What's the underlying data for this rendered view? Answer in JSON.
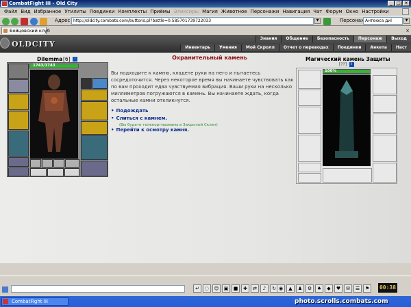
{
  "window": {
    "title": "CombatFight III - Old City"
  },
  "menu": [
    {
      "label": "Файл",
      "disabled": false
    },
    {
      "label": "Вид",
      "disabled": false
    },
    {
      "label": "Избранное",
      "disabled": false
    },
    {
      "label": "Утилиты",
      "disabled": false
    },
    {
      "label": "Поединки",
      "disabled": false
    },
    {
      "label": "Комплекты",
      "disabled": false
    },
    {
      "label": "Приёмы",
      "disabled": false
    },
    {
      "label": "Эликсиры",
      "disabled": true
    },
    {
      "label": "Магия",
      "disabled": false
    },
    {
      "label": "Животное",
      "disabled": false
    },
    {
      "label": "Персонажи",
      "disabled": false
    },
    {
      "label": "Навигация",
      "disabled": false
    },
    {
      "label": "Чат",
      "disabled": false
    },
    {
      "label": "Форум",
      "disabled": false
    },
    {
      "label": "Окно",
      "disabled": false
    },
    {
      "label": "Настройки",
      "disabled": false
    }
  ],
  "address": {
    "label": "Адрес",
    "url": "http://oldcity.combats.com/buttons.pl?battle=0.585701739722033",
    "persona_label": "Персонаж",
    "persona_value": "Антеюса диl"
  },
  "tab": {
    "label": "Бойцовский клуб"
  },
  "header": {
    "logo": "OLDCITY",
    "nav_top": [
      "Знания",
      "Общение",
      "Безопасность",
      "Персонаж",
      "Выход"
    ],
    "nav_bottom": [
      "Инвентарь",
      "Умения",
      "Мой Скролл",
      "Отчет о переводах",
      "Поединки",
      "Анкета",
      "Наст"
    ]
  },
  "character": {
    "name": "Dilemma",
    "level": "[6]",
    "hp_text": "1743/1743",
    "hp_fraction": 1.0
  },
  "center": {
    "title": "Охранительный камень",
    "description": "Вы подходите к камню, кладете руки на него и пытаетесь сосредоточится. Через некоторое время вы начинаете чувствовать как по вам проходит едва чувствуемая вибрация. Ваши руки на несколько миллиметров погружаются в камень. Вы начинаете ждать, когда остальные камни откликнутся.",
    "options": [
      {
        "label": "Подождать"
      },
      {
        "label": "Слиться с камнем."
      },
      {
        "label": "Перейти к осмотру камня."
      }
    ],
    "note": "(Вы будете телепортированы в Закрытый Склеп)"
  },
  "stone": {
    "title": "Магический камень Защиты",
    "sub": "[??]",
    "bar_text": "100%",
    "bar_fraction": 1.0
  },
  "clock": "00:38",
  "taskbar": {
    "item": "CombatFight III"
  },
  "watermark": "photo.scrolls.combats.com",
  "colors": {
    "accent_title": "#8b1010",
    "link": "#0d2a8a",
    "note": "#2e8b2e",
    "hp": "#3bb03b"
  }
}
